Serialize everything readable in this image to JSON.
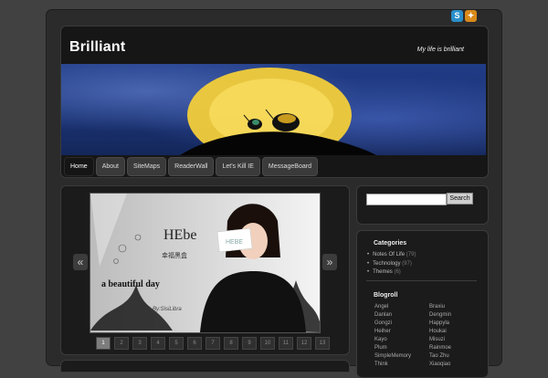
{
  "header": {
    "title": "Brilliant",
    "tagline": "My life is brilliant"
  },
  "nav": {
    "items": [
      "Home",
      "About",
      "SiteMaps",
      "ReaderWall",
      "Let's Kill IE",
      "MessageBoard"
    ],
    "active": "Home"
  },
  "slider": {
    "caption_title": "HEbe",
    "caption_cn": "幸福黑盒",
    "caption_line": "a beautiful day",
    "caption_by": "By:SisiLibra",
    "card_text": "HEBE",
    "pages": [
      "1",
      "2",
      "3",
      "4",
      "5",
      "6",
      "7",
      "8",
      "9",
      "10",
      "11",
      "12",
      "13"
    ]
  },
  "search": {
    "button": "Search",
    "placeholder": ""
  },
  "categories": {
    "title": "Categories",
    "items": [
      {
        "name": "Notes Of Life",
        "count": "(79)"
      },
      {
        "name": "Technology",
        "count": "(97)"
      },
      {
        "name": "Themes",
        "count": "(6)"
      }
    ]
  },
  "blogroll": {
    "title": "Blogroll",
    "links": [
      "Angel",
      "Braxiu",
      "Danlan",
      "Dengmin",
      "Gongzi",
      "Happyla",
      "Heiher",
      "Houkai",
      "Kayo",
      "Misuzi",
      "Plum",
      "Rainmoe",
      "SimpleMemory",
      "Tao Zhu",
      "Think",
      "Xiaoqiao"
    ]
  },
  "icons": {
    "top_left": "s",
    "top_right": "rss"
  },
  "colors": {
    "page_bg": "#414141",
    "panel_bg": "#1b1b1b",
    "banner_blue": "#203c86",
    "moon_yellow": "#f2cd3a",
    "accent_orange": "#d98a1b",
    "accent_blue": "#2a8fc9"
  }
}
